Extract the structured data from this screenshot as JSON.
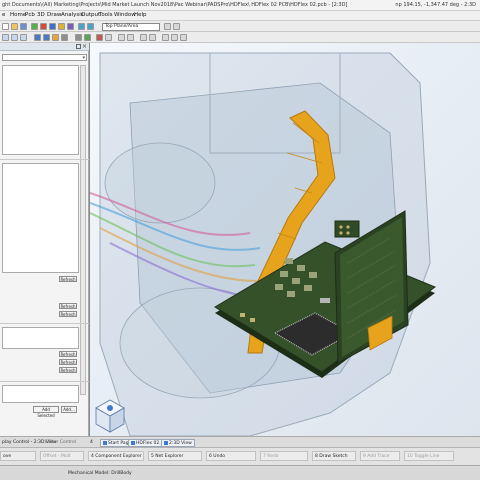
{
  "window": {
    "title": "ght Documents\\(All) Marketing\\Projects\\Mid Market Launch Nov2018\\Pac Webinar\\PADSPro\\HDFlex\\ HDFlex 02 PCB\\HDFlex 02.pcb - [2:3D]",
    "coords": "np 194.15, -1,347.47 deg - 2:3D"
  },
  "menu": [
    "e",
    "Home",
    "Pcb",
    "3D",
    "Draw",
    "Analysis",
    "Output",
    "Tools",
    "Window",
    "Help"
  ],
  "toolbar": {
    "layer_select": "Top Plane/Area"
  },
  "left_panel": {
    "refresh_label": "Refresh",
    "add_selected_label": "Add Selected",
    "add_label": "Add..."
  },
  "tabs": {
    "display_control": "play Control - 2:3D View",
    "editor_control": "Editor Control",
    "number": "4",
    "start_page": "Start Page",
    "pcb_tab": "HDFlex 02...",
    "view_tab": "2:3D View"
  },
  "fkeys": [
    {
      "label": "ove",
      "dim": false
    },
    {
      "label": "Offset - Mult",
      "dim": true
    },
    {
      "label": "4 Component Explorer",
      "dim": false
    },
    {
      "label": "5 Net Explorer",
      "dim": false
    },
    {
      "label": "6 Undo",
      "dim": false
    },
    {
      "label": "7 Redo",
      "dim": true
    },
    {
      "label": "8 Draw Sketch",
      "dim": false
    },
    {
      "label": "9 Add Trace",
      "dim": true
    },
    {
      "label": "10 Toggle Line",
      "dim": true
    }
  ],
  "status": {
    "model": "Mechanical Model: DrillBody"
  },
  "colors": {
    "flex": "#e8a31c",
    "board": "#2f4a24",
    "viewport_bg": "#eef3f8"
  }
}
